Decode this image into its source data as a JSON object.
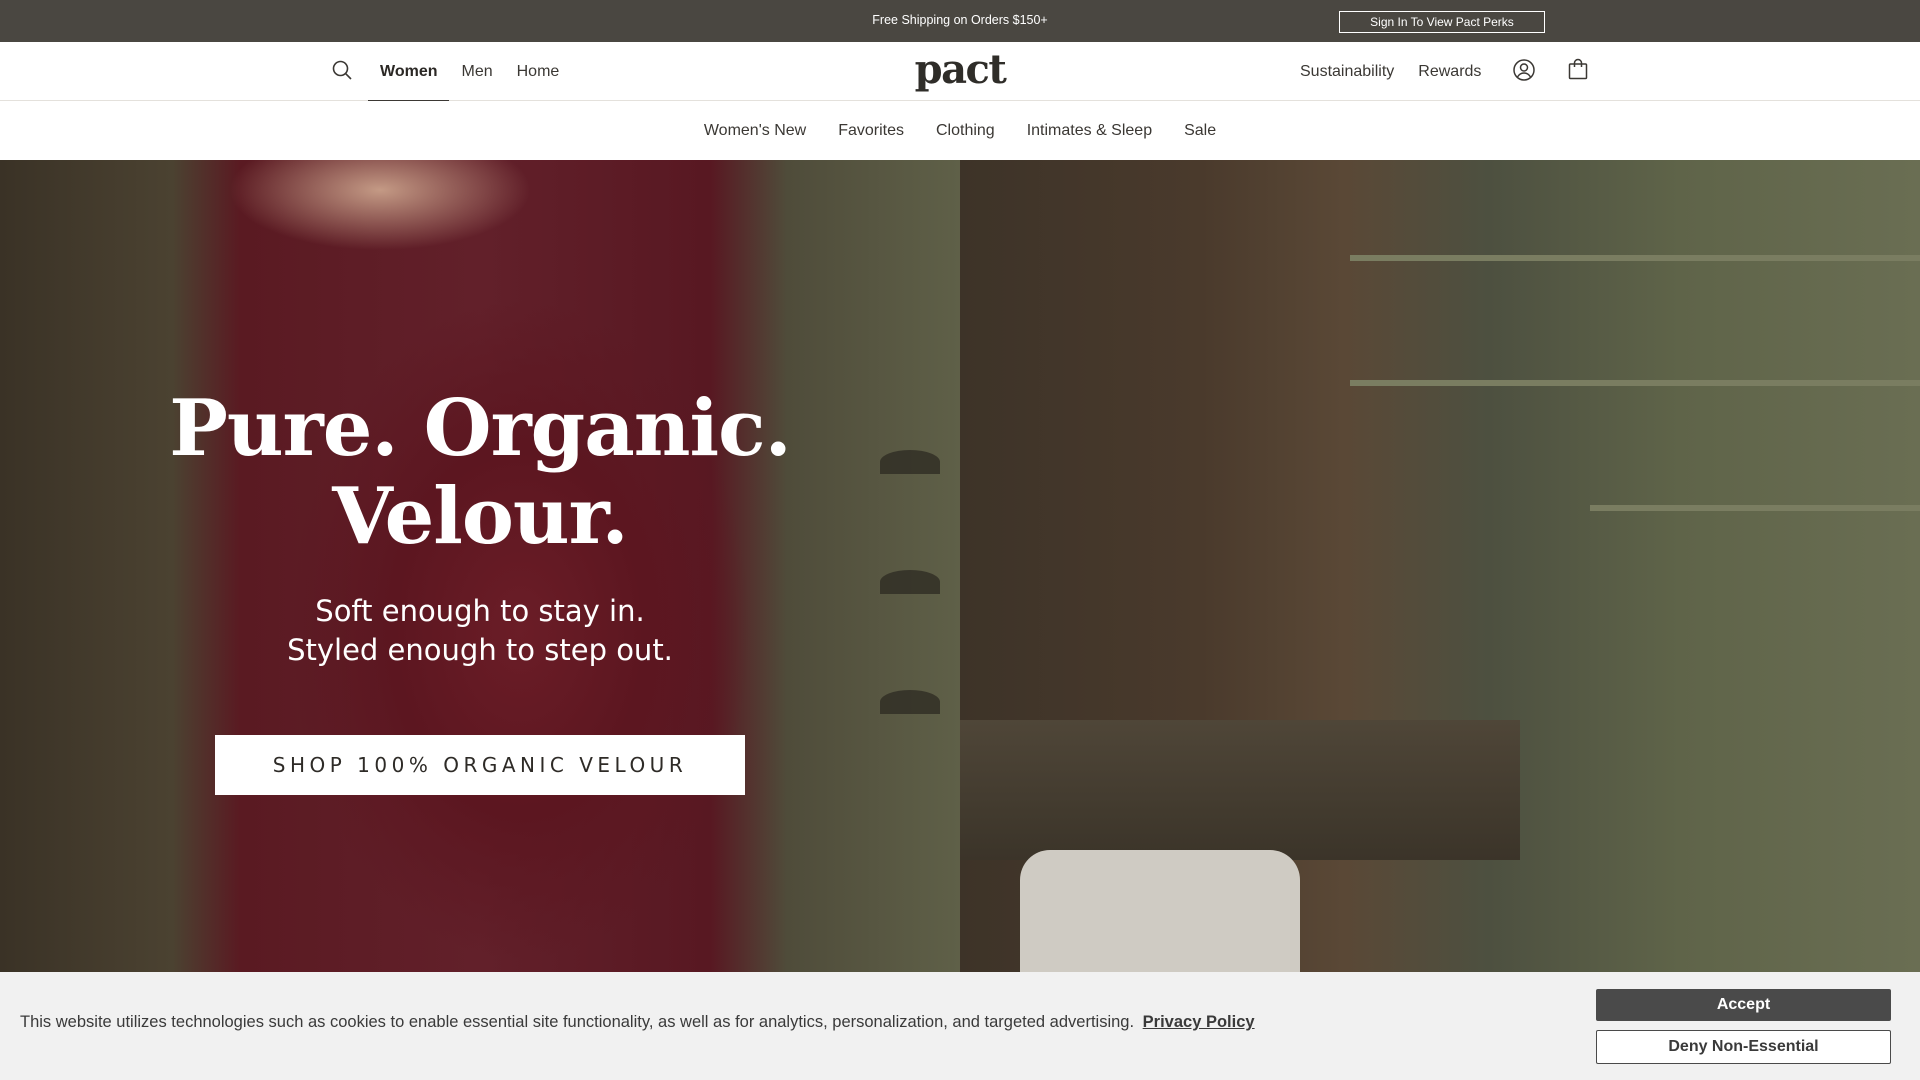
{
  "announcement": {
    "text": "Free Shipping on Orders $150+",
    "perks_button": "Sign In To View Pact Perks"
  },
  "header": {
    "logo": "pact",
    "nav": [
      {
        "label": "Women",
        "active": true
      },
      {
        "label": "Men",
        "active": false
      },
      {
        "label": "Home",
        "active": false
      }
    ],
    "right_links": [
      "Sustainability",
      "Rewards"
    ],
    "icons": [
      "search-icon",
      "account-icon",
      "shopping-bag-icon"
    ]
  },
  "subnav": {
    "items": [
      "Women's New",
      "Favorites",
      "Clothing",
      "Intimates & Sleep",
      "Sale"
    ]
  },
  "hero": {
    "title_line1": "Pure. Organic.",
    "title_line2": "Velour.",
    "subtitle_line1": "Soft enough to stay in.",
    "subtitle_line2": "Styled enough to step out.",
    "cta": "SHOP 100% ORGANIC VELOUR"
  },
  "cookie_banner": {
    "text": "This website utilizes technologies such as cookies to enable essential site functionality, as well as for analytics, personalization, and targeted advertising.",
    "policy_link": "Privacy Policy",
    "accept": "Accept",
    "deny": "Deny Non-Essential"
  },
  "colors": {
    "announcement_bg": "#4a4741",
    "velour_burgundy": "#62202a",
    "cookie_bg": "#f1f1f1",
    "accept_bg": "#4a4a4a"
  }
}
